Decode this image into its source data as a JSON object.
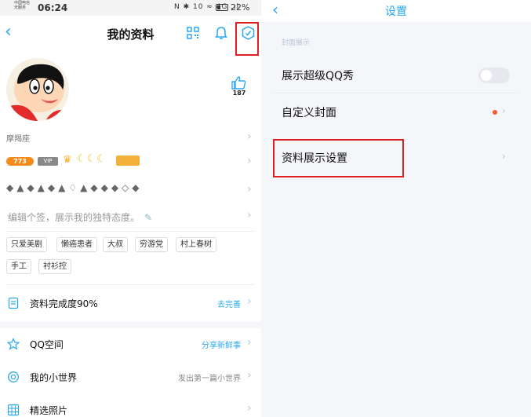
{
  "status_bar": {
    "carrier_line1": "中国电信",
    "carrier_line2": "无服务",
    "time": "06:24",
    "icons": "N ✱ 10 ≈ 4G .ıl",
    "battery": "22%"
  },
  "profile": {
    "title": "我的资料",
    "like_count": "187",
    "constellation": "摩羯座",
    "level_badge": "773",
    "vip_badge": "VIP",
    "signature_placeholder": "编辑个签，展示我的独特态度。",
    "tags": [
      "只爱美剧",
      "懒癌患者",
      "大叔",
      "穷游党",
      "村上春树",
      "手工",
      "衬衫控"
    ],
    "list": [
      {
        "label": "资料完成度90%",
        "right": "去完善",
        "icon": "document-icon"
      },
      {
        "label": "QQ空间",
        "right": "分享新鲜事",
        "icon": "star-icon"
      },
      {
        "label": "我的小世界",
        "right": "发出第一篇小世界",
        "icon": "circle-icon"
      },
      {
        "label": "精选照片",
        "right": "",
        "icon": "grid-icon"
      }
    ]
  },
  "settings": {
    "title": "设置",
    "section": "封面展示",
    "rows": [
      {
        "label": "展示超级QQ秀"
      },
      {
        "label": "自定义封面"
      },
      {
        "label": "资料展示设置"
      }
    ],
    "super_qq_show_enabled": false
  },
  "colors": {
    "accent": "#2aa8ee",
    "highlight": "#e02020",
    "level": "#f48b1b",
    "dot": "#f35a2c"
  }
}
